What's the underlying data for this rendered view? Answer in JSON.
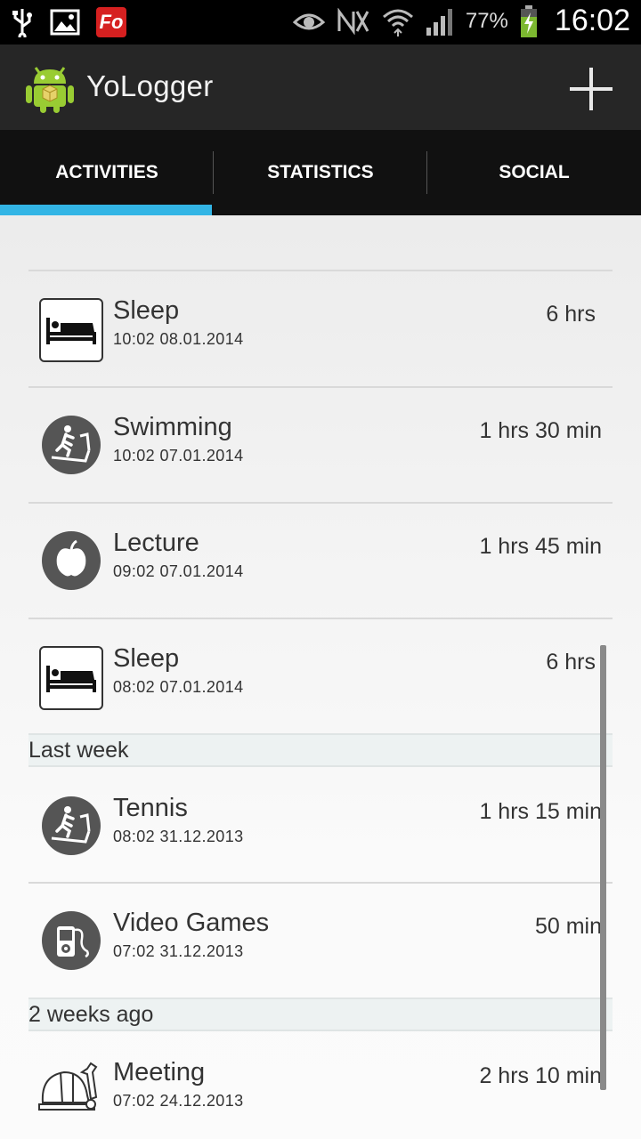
{
  "status_bar": {
    "carrier_icon": "Fo",
    "battery_percent": "77%",
    "time": "16:02",
    "icons": [
      "usb-icon",
      "image-icon",
      "fo-app-icon",
      "eye-icon",
      "nfc-icon",
      "wifi-icon",
      "signal-icon",
      "battery-charging-icon"
    ]
  },
  "action_bar": {
    "title": "YoLogger",
    "logo_icon": "android-logo-icon",
    "add_icon": "plus-icon"
  },
  "tabs": [
    {
      "label": "ACTIVITIES",
      "selected": true
    },
    {
      "label": "STATISTICS",
      "selected": false
    },
    {
      "label": "SOCIAL",
      "selected": false
    }
  ],
  "accent_color": "#33b5e5",
  "activities": [
    {
      "title": "Sleep",
      "date": "10:02 08.01.2014",
      "duration": "6 hrs",
      "icon": "bed-icon"
    },
    {
      "title": "Swimming",
      "date": "10:02 07.01.2014",
      "duration": "1 hrs 30 min",
      "icon": "treadmill-icon"
    },
    {
      "title": "Lecture",
      "date": "09:02 07.01.2014",
      "duration": "1 hrs 45 min",
      "icon": "apple-icon"
    },
    {
      "title": "Sleep",
      "date": "08:02 07.01.2014",
      "duration": "6 hrs",
      "icon": "bed-icon"
    }
  ],
  "sections": [
    {
      "header": "Last week",
      "items": [
        {
          "title": "Tennis",
          "date": "08:02 31.12.2013",
          "duration": "1 hrs 15 min",
          "icon": "treadmill-icon"
        },
        {
          "title": "Video Games",
          "date": "07:02 31.12.2013",
          "duration": "50 min",
          "icon": "music-player-icon"
        }
      ]
    },
    {
      "header": "2 weeks ago",
      "items": [
        {
          "title": "Meeting",
          "date": "07:02 24.12.2013",
          "duration": "2 hrs 10 min",
          "icon": "hardhat-wrench-icon"
        }
      ]
    }
  ]
}
